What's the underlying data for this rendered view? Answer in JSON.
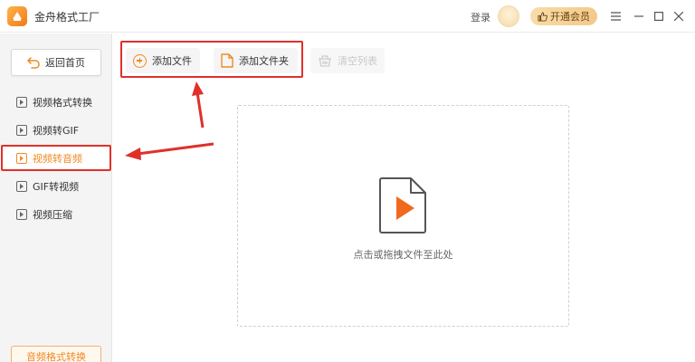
{
  "app": {
    "title": "金舟格式工厂",
    "login": "登录",
    "vip_button": "开通会员"
  },
  "sidebar": {
    "home_button": "返回首页",
    "items": [
      {
        "label": "视频格式转换",
        "icon": "video-file-icon"
      },
      {
        "label": "视频转GIF",
        "icon": "image-file-icon"
      },
      {
        "label": "视频转音频",
        "icon": "audio-file-icon",
        "active": true
      },
      {
        "label": "GIF转视频",
        "icon": "play-file-icon"
      },
      {
        "label": "视频压缩",
        "icon": "compress-file-icon"
      }
    ],
    "bottom_tag": "音频格式转换"
  },
  "toolbar": {
    "add_file": "添加文件",
    "add_folder": "添加文件夹",
    "clear_list": "清空列表"
  },
  "dropzone": {
    "hint": "点击或拖拽文件至此处"
  },
  "colors": {
    "accent": "#f08a24",
    "annotation": "#e0302a",
    "play_icon": "#f06a1e"
  }
}
